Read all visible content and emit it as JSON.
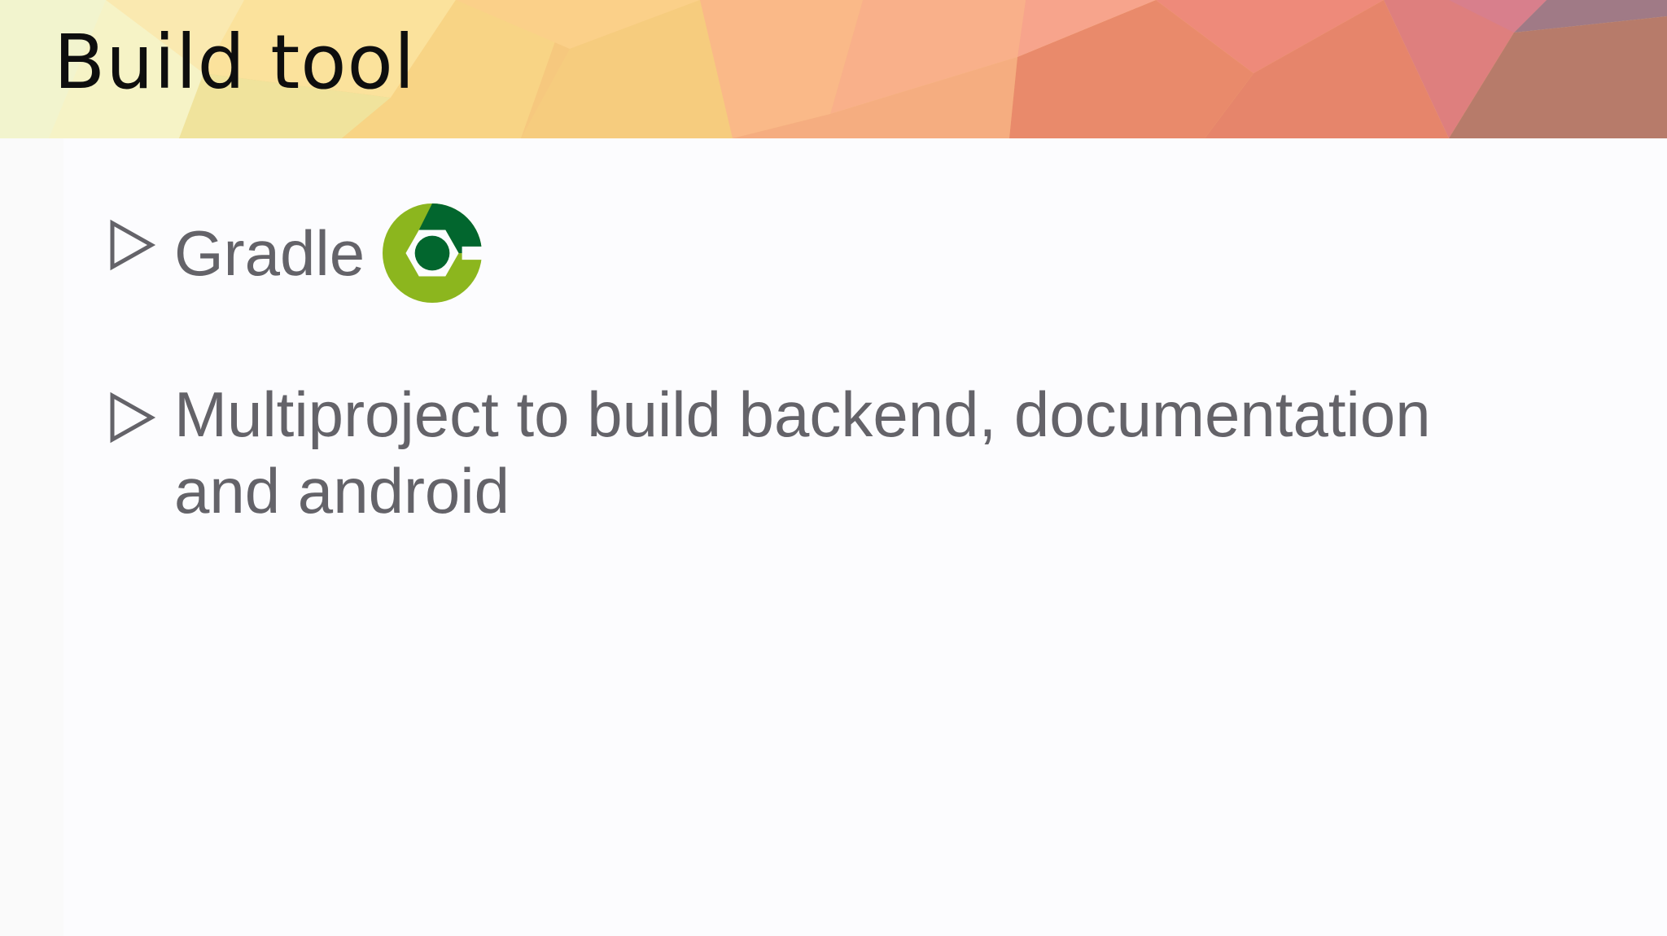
{
  "slide": {
    "title": "Build tool",
    "bullets": [
      {
        "text": "Gradle",
        "icon": "gradle-logo-icon"
      },
      {
        "text": "Multiproject to build backend, documentation and android"
      }
    ]
  },
  "colors": {
    "text": "#646369",
    "title": "#0e0e0e",
    "gradle_dark": "#02662e",
    "gradle_light": "#8cb61e"
  }
}
